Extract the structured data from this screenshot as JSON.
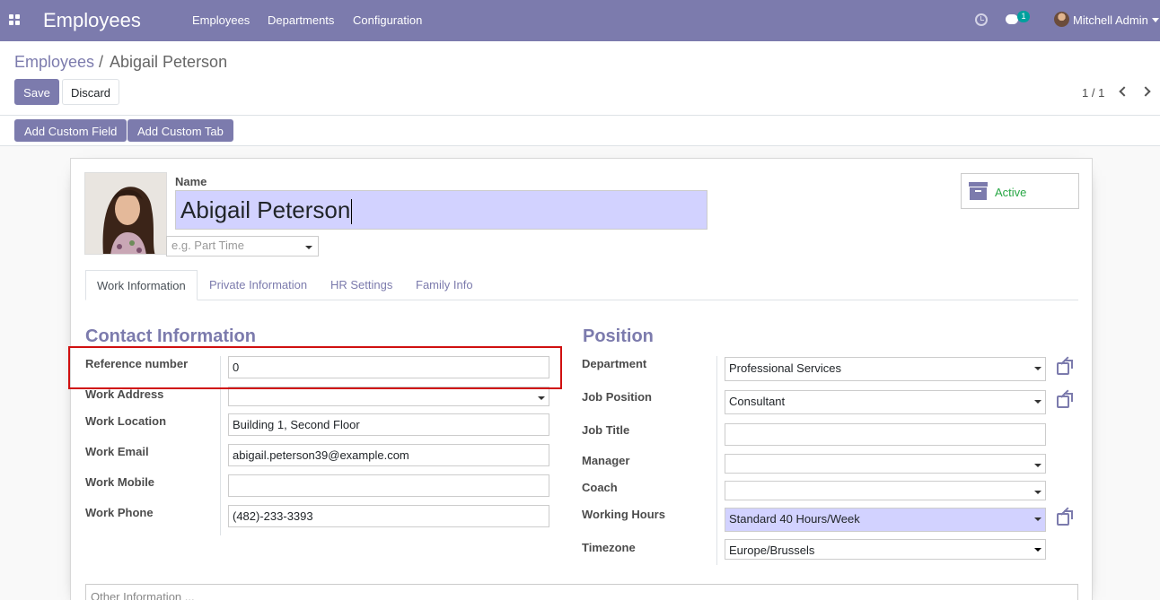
{
  "topbar": {
    "app_title": "Employees",
    "nav": [
      "Employees",
      "Departments",
      "Configuration"
    ],
    "chat_count": "1",
    "user_name": "Mitchell Admin",
    "icons": [
      "apps-icon",
      "clock-icon",
      "chat-icon",
      "avatar",
      "chevron-down-icon"
    ]
  },
  "breadcrumb": {
    "parent": "Employees",
    "separator": "/",
    "current": "Abigail Peterson"
  },
  "buttons": {
    "save": "Save",
    "discard": "Discard",
    "add_custom_field": "Add Custom Field",
    "add_custom_tab": "Add Custom Tab"
  },
  "pager": {
    "value": "1 / 1"
  },
  "employee": {
    "name_label": "Name",
    "name": "Abigail Peterson",
    "job_placeholder": "e.g. Part Time",
    "status": "Active"
  },
  "tabs": [
    "Work Information",
    "Private Information",
    "HR Settings",
    "Family Info"
  ],
  "contact": {
    "title": "Contact Information",
    "fields": [
      {
        "label": "Reference number",
        "value": "0"
      },
      {
        "label": "Work Address",
        "value": ""
      },
      {
        "label": "Work Location",
        "value": "Building 1, Second Floor"
      },
      {
        "label": "Work Email",
        "value": "abigail.peterson39@example.com"
      },
      {
        "label": "Work Mobile",
        "value": ""
      },
      {
        "label": "Work Phone",
        "value": "(482)-233-3393"
      }
    ]
  },
  "position": {
    "title": "Position",
    "fields": [
      {
        "label": "Department",
        "value": "Professional Services"
      },
      {
        "label": "Job Position",
        "value": "Consultant"
      },
      {
        "label": "Job Title",
        "value": ""
      },
      {
        "label": "Manager",
        "value": ""
      },
      {
        "label": "Coach",
        "value": ""
      },
      {
        "label": "Working Hours",
        "value": "Standard 40 Hours/Week"
      },
      {
        "label": "Timezone",
        "value": "Europe/Brussels"
      }
    ]
  },
  "other_info_placeholder": "Other Information ...",
  "colors": {
    "brand": "#7c7bad",
    "active_status": "#28a745",
    "highlight_field": "#d2d2ff",
    "annotation_box": "#d01010"
  }
}
